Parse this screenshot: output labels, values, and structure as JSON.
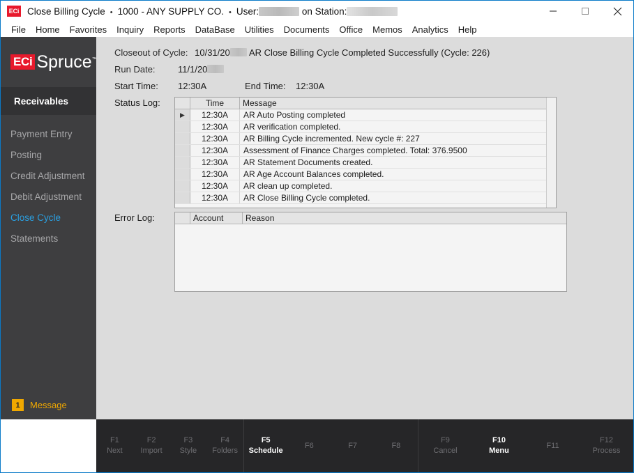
{
  "window": {
    "app_badge": "ECi",
    "title": "Close Billing Cycle",
    "company": "1000 - ANY SUPPLY CO.",
    "user_label": "User:",
    "station_label": "on Station:",
    "separator": "•",
    "minimize_icon": "minimize-icon",
    "maximize_icon": "maximize-icon",
    "close_icon": "close-icon"
  },
  "menubar": {
    "items": [
      {
        "label": "File"
      },
      {
        "label": "Home"
      },
      {
        "label": "Favorites"
      },
      {
        "label": "Inquiry"
      },
      {
        "label": "Reports"
      },
      {
        "label": "DataBase"
      },
      {
        "label": "Utilities"
      },
      {
        "label": "Documents"
      },
      {
        "label": "Office"
      },
      {
        "label": "Memos"
      },
      {
        "label": "Analytics"
      },
      {
        "label": "Help"
      }
    ]
  },
  "sidebar": {
    "logo_eci": "ECi",
    "logo_spruce": "Spruce",
    "logo_tm": "™",
    "section_title": "Receivables",
    "items": [
      {
        "label": "Payment Entry",
        "active": false
      },
      {
        "label": "Posting",
        "active": false
      },
      {
        "label": "Credit Adjustment",
        "active": false
      },
      {
        "label": "Debit Adjustment",
        "active": false
      },
      {
        "label": "Close Cycle",
        "active": true
      },
      {
        "label": "Statements",
        "active": false
      }
    ],
    "message_badge": {
      "count": "1",
      "label": "Message"
    }
  },
  "form": {
    "closeout_label": "Closeout of Cycle:",
    "closeout_value": "10/31/20",
    "run_date_label": "Run Date:",
    "run_date_value": "11/1/20",
    "start_time_label": "Start Time:",
    "start_time_value": "12:30A",
    "end_time_label": "End Time:",
    "end_time_value": "12:30A",
    "completion_message": "AR Close Billing Cycle Completed Successfully (Cycle: 226)"
  },
  "status_log": {
    "label": "Status Log:",
    "columns": [
      "",
      "Time",
      "Message"
    ],
    "rows": [
      {
        "marker": "▶",
        "time": "12:30A",
        "message": "AR Auto Posting completed"
      },
      {
        "marker": "",
        "time": "12:30A",
        "message": "AR verification completed."
      },
      {
        "marker": "",
        "time": "12:30A",
        "message": "AR Billing Cycle incremented.  New cycle #: 227"
      },
      {
        "marker": "",
        "time": "12:30A",
        "message": "Assessment of Finance Charges completed.  Total: 376.9500"
      },
      {
        "marker": "",
        "time": "12:30A",
        "message": "AR Statement Documents created."
      },
      {
        "marker": "",
        "time": "12:30A",
        "message": "AR Age Account Balances completed."
      },
      {
        "marker": "",
        "time": "12:30A",
        "message": "AR clean up completed."
      },
      {
        "marker": "",
        "time": "12:30A",
        "message": "AR Close Billing Cycle completed."
      }
    ]
  },
  "error_log": {
    "label": "Error Log:",
    "columns": [
      "",
      "Account",
      "Reason"
    ],
    "rows": []
  },
  "function_keys": {
    "group1": [
      {
        "key": "F1",
        "name": "Next",
        "enabled": false
      },
      {
        "key": "F2",
        "name": "Import",
        "enabled": false
      },
      {
        "key": "F3",
        "name": "Style",
        "enabled": false
      },
      {
        "key": "F4",
        "name": "Folders",
        "enabled": false
      }
    ],
    "group2": [
      {
        "key": "F5",
        "name": "Schedule",
        "enabled": true
      },
      {
        "key": "F6",
        "name": "",
        "enabled": false
      },
      {
        "key": "F7",
        "name": "",
        "enabled": false
      },
      {
        "key": "F8",
        "name": "",
        "enabled": false
      }
    ],
    "group3": [
      {
        "key": "F9",
        "name": "Cancel",
        "enabled": false
      },
      {
        "key": "F10",
        "name": "Menu",
        "enabled": true
      },
      {
        "key": "F11",
        "name": "",
        "enabled": false
      },
      {
        "key": "F12",
        "name": "Process",
        "enabled": false
      }
    ]
  },
  "colors": {
    "accent_blue": "#2a9fe0",
    "brand_red": "#e8192c",
    "badge_amber": "#f0a800",
    "sidebar_dark": "#3e3e40",
    "content_bg": "#dcdcdc"
  }
}
